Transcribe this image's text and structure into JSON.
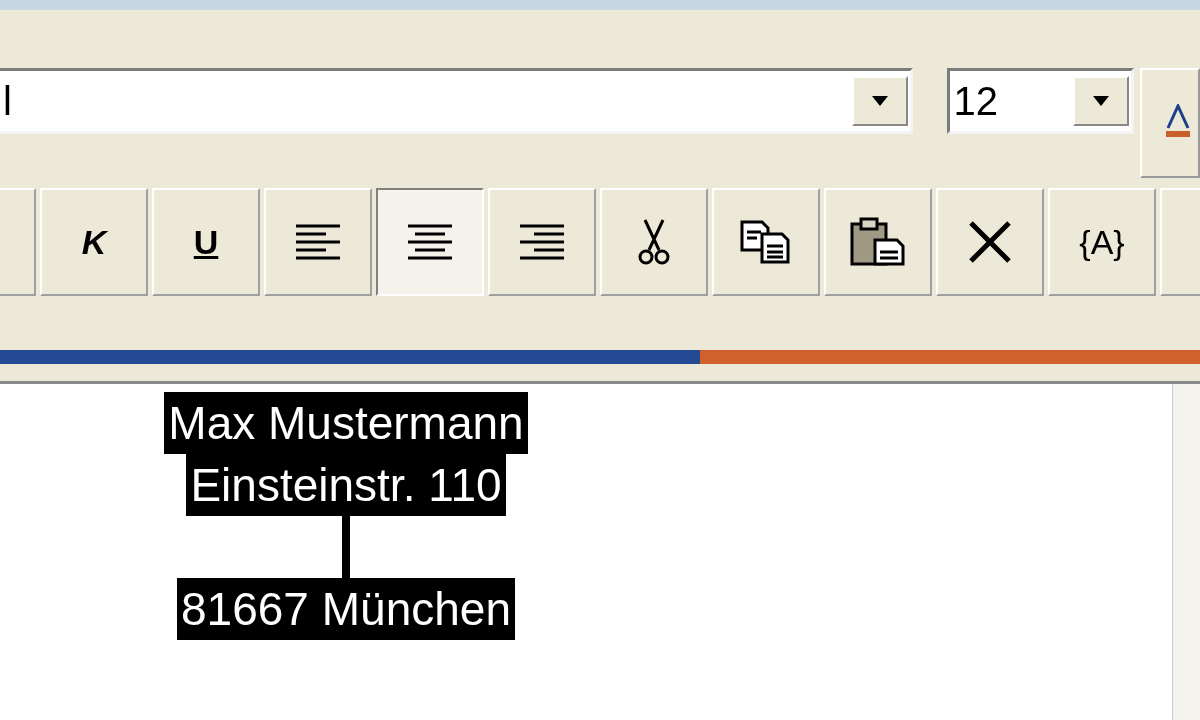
{
  "format_bar": {
    "font": {
      "value": "l"
    },
    "size": {
      "value": "12"
    }
  },
  "toolbar": [
    {
      "kind": "blank",
      "selected": false
    },
    {
      "kind": "italic",
      "label": "K",
      "selected": false
    },
    {
      "kind": "underline",
      "label": "U",
      "selected": false
    },
    {
      "kind": "align-left",
      "selected": false
    },
    {
      "kind": "align-center",
      "selected": true
    },
    {
      "kind": "align-right",
      "selected": false
    },
    {
      "kind": "cut",
      "selected": false
    },
    {
      "kind": "copy",
      "selected": false
    },
    {
      "kind": "paste",
      "selected": false
    },
    {
      "kind": "delete",
      "selected": false
    },
    {
      "kind": "field",
      "label": "{A}",
      "selected": false
    },
    {
      "kind": "partial",
      "selected": false
    }
  ],
  "document": {
    "lines": [
      {
        "text": "Max Mustermann",
        "highlighted": true
      },
      {
        "text": "Einsteinstr. 110",
        "highlighted": true
      },
      {
        "text": "81667 München",
        "highlighted": true
      }
    ]
  }
}
